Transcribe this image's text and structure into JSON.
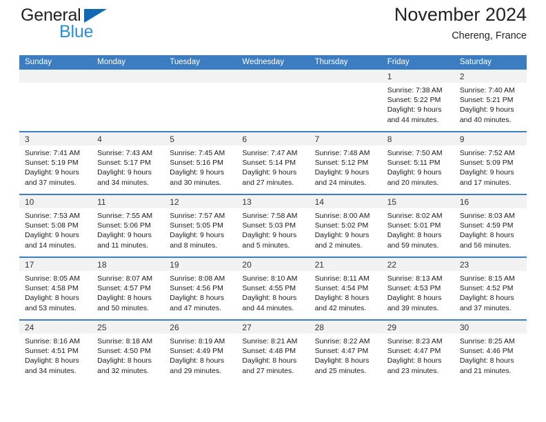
{
  "brand": {
    "name_part1": "General",
    "name_part2": "Blue",
    "triangle_color": "#1268b3",
    "blue_color": "#2b8fd4"
  },
  "header": {
    "title": "November 2024",
    "subtitle": "Chereng, France",
    "accent_color": "#3b7dc0"
  },
  "weekday_headers": [
    "Sunday",
    "Monday",
    "Tuesday",
    "Wednesday",
    "Thursday",
    "Friday",
    "Saturday"
  ],
  "weeks": [
    [
      {
        "day": "",
        "lines": [
          "",
          "",
          "",
          ""
        ]
      },
      {
        "day": "",
        "lines": [
          "",
          "",
          "",
          ""
        ]
      },
      {
        "day": "",
        "lines": [
          "",
          "",
          "",
          ""
        ]
      },
      {
        "day": "",
        "lines": [
          "",
          "",
          "",
          ""
        ]
      },
      {
        "day": "",
        "lines": [
          "",
          "",
          "",
          ""
        ]
      },
      {
        "day": "1",
        "lines": [
          "Sunrise: 7:38 AM",
          "Sunset: 5:22 PM",
          "Daylight: 9 hours",
          "and 44 minutes."
        ]
      },
      {
        "day": "2",
        "lines": [
          "Sunrise: 7:40 AM",
          "Sunset: 5:21 PM",
          "Daylight: 9 hours",
          "and 40 minutes."
        ]
      }
    ],
    [
      {
        "day": "3",
        "lines": [
          "Sunrise: 7:41 AM",
          "Sunset: 5:19 PM",
          "Daylight: 9 hours",
          "and 37 minutes."
        ]
      },
      {
        "day": "4",
        "lines": [
          "Sunrise: 7:43 AM",
          "Sunset: 5:17 PM",
          "Daylight: 9 hours",
          "and 34 minutes."
        ]
      },
      {
        "day": "5",
        "lines": [
          "Sunrise: 7:45 AM",
          "Sunset: 5:16 PM",
          "Daylight: 9 hours",
          "and 30 minutes."
        ]
      },
      {
        "day": "6",
        "lines": [
          "Sunrise: 7:47 AM",
          "Sunset: 5:14 PM",
          "Daylight: 9 hours",
          "and 27 minutes."
        ]
      },
      {
        "day": "7",
        "lines": [
          "Sunrise: 7:48 AM",
          "Sunset: 5:12 PM",
          "Daylight: 9 hours",
          "and 24 minutes."
        ]
      },
      {
        "day": "8",
        "lines": [
          "Sunrise: 7:50 AM",
          "Sunset: 5:11 PM",
          "Daylight: 9 hours",
          "and 20 minutes."
        ]
      },
      {
        "day": "9",
        "lines": [
          "Sunrise: 7:52 AM",
          "Sunset: 5:09 PM",
          "Daylight: 9 hours",
          "and 17 minutes."
        ]
      }
    ],
    [
      {
        "day": "10",
        "lines": [
          "Sunrise: 7:53 AM",
          "Sunset: 5:08 PM",
          "Daylight: 9 hours",
          "and 14 minutes."
        ]
      },
      {
        "day": "11",
        "lines": [
          "Sunrise: 7:55 AM",
          "Sunset: 5:06 PM",
          "Daylight: 9 hours",
          "and 11 minutes."
        ]
      },
      {
        "day": "12",
        "lines": [
          "Sunrise: 7:57 AM",
          "Sunset: 5:05 PM",
          "Daylight: 9 hours",
          "and 8 minutes."
        ]
      },
      {
        "day": "13",
        "lines": [
          "Sunrise: 7:58 AM",
          "Sunset: 5:03 PM",
          "Daylight: 9 hours",
          "and 5 minutes."
        ]
      },
      {
        "day": "14",
        "lines": [
          "Sunrise: 8:00 AM",
          "Sunset: 5:02 PM",
          "Daylight: 9 hours",
          "and 2 minutes."
        ]
      },
      {
        "day": "15",
        "lines": [
          "Sunrise: 8:02 AM",
          "Sunset: 5:01 PM",
          "Daylight: 8 hours",
          "and 59 minutes."
        ]
      },
      {
        "day": "16",
        "lines": [
          "Sunrise: 8:03 AM",
          "Sunset: 4:59 PM",
          "Daylight: 8 hours",
          "and 56 minutes."
        ]
      }
    ],
    [
      {
        "day": "17",
        "lines": [
          "Sunrise: 8:05 AM",
          "Sunset: 4:58 PM",
          "Daylight: 8 hours",
          "and 53 minutes."
        ]
      },
      {
        "day": "18",
        "lines": [
          "Sunrise: 8:07 AM",
          "Sunset: 4:57 PM",
          "Daylight: 8 hours",
          "and 50 minutes."
        ]
      },
      {
        "day": "19",
        "lines": [
          "Sunrise: 8:08 AM",
          "Sunset: 4:56 PM",
          "Daylight: 8 hours",
          "and 47 minutes."
        ]
      },
      {
        "day": "20",
        "lines": [
          "Sunrise: 8:10 AM",
          "Sunset: 4:55 PM",
          "Daylight: 8 hours",
          "and 44 minutes."
        ]
      },
      {
        "day": "21",
        "lines": [
          "Sunrise: 8:11 AM",
          "Sunset: 4:54 PM",
          "Daylight: 8 hours",
          "and 42 minutes."
        ]
      },
      {
        "day": "22",
        "lines": [
          "Sunrise: 8:13 AM",
          "Sunset: 4:53 PM",
          "Daylight: 8 hours",
          "and 39 minutes."
        ]
      },
      {
        "day": "23",
        "lines": [
          "Sunrise: 8:15 AM",
          "Sunset: 4:52 PM",
          "Daylight: 8 hours",
          "and 37 minutes."
        ]
      }
    ],
    [
      {
        "day": "24",
        "lines": [
          "Sunrise: 8:16 AM",
          "Sunset: 4:51 PM",
          "Daylight: 8 hours",
          "and 34 minutes."
        ]
      },
      {
        "day": "25",
        "lines": [
          "Sunrise: 8:18 AM",
          "Sunset: 4:50 PM",
          "Daylight: 8 hours",
          "and 32 minutes."
        ]
      },
      {
        "day": "26",
        "lines": [
          "Sunrise: 8:19 AM",
          "Sunset: 4:49 PM",
          "Daylight: 8 hours",
          "and 29 minutes."
        ]
      },
      {
        "day": "27",
        "lines": [
          "Sunrise: 8:21 AM",
          "Sunset: 4:48 PM",
          "Daylight: 8 hours",
          "and 27 minutes."
        ]
      },
      {
        "day": "28",
        "lines": [
          "Sunrise: 8:22 AM",
          "Sunset: 4:47 PM",
          "Daylight: 8 hours",
          "and 25 minutes."
        ]
      },
      {
        "day": "29",
        "lines": [
          "Sunrise: 8:23 AM",
          "Sunset: 4:47 PM",
          "Daylight: 8 hours",
          "and 23 minutes."
        ]
      },
      {
        "day": "30",
        "lines": [
          "Sunrise: 8:25 AM",
          "Sunset: 4:46 PM",
          "Daylight: 8 hours",
          "and 21 minutes."
        ]
      }
    ]
  ]
}
